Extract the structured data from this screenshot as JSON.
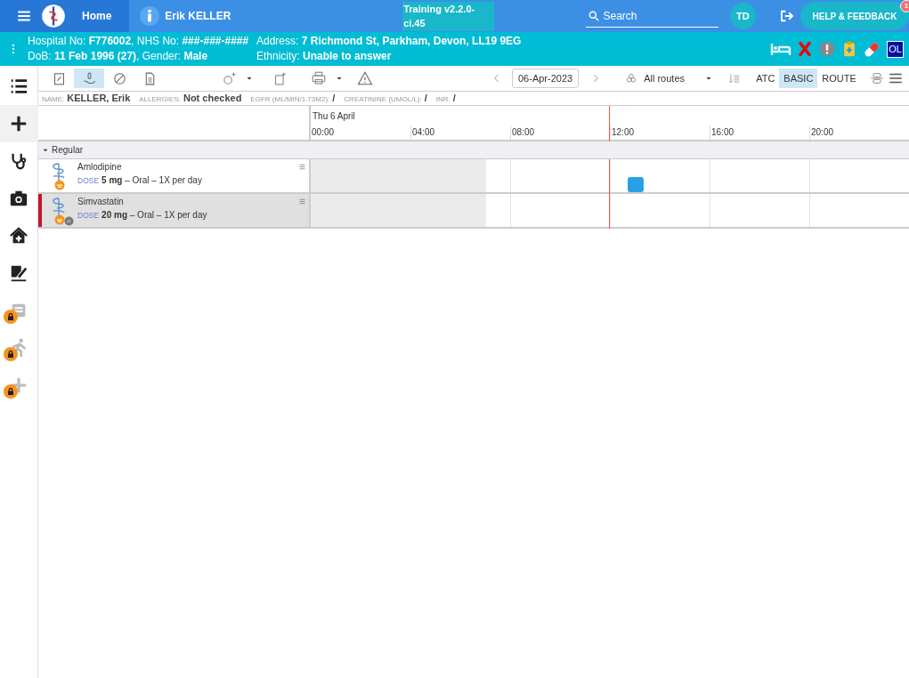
{
  "top_bar": {
    "home": "Home",
    "patient": "Erik KELLER",
    "environment": "Training v2.2.0-ci.45",
    "search_placeholder": "Search",
    "user_initials": "TD",
    "help": "HELP & FEEDBACK",
    "help_count": "1"
  },
  "banner": {
    "line1_left": "Hospital No: **F776002**, NHS No: **###-###-####**",
    "line2_left": "DoB: **11 Feb 1996 (27)**, Gender: **Male**",
    "line1_right": "Address: **7 Richmond St, Parkham, Devon, LL19 9EG**",
    "line2_right": "Ethnicity: **Unable to answer**",
    "badge": "OL"
  },
  "sidebar": {
    "items": [
      {
        "kind": "list",
        "locked": false,
        "selected": false
      },
      {
        "kind": "plus",
        "locked": false,
        "selected": true
      },
      {
        "kind": "stethoscope",
        "locked": false,
        "selected": false
      },
      {
        "kind": "camera",
        "locked": false,
        "selected": false
      },
      {
        "kind": "house",
        "locked": false,
        "selected": false
      },
      {
        "kind": "sign",
        "locked": false,
        "selected": false
      },
      {
        "kind": "clipboard",
        "locked": true,
        "selected": false
      },
      {
        "kind": "walk",
        "locked": true,
        "selected": false
      },
      {
        "kind": "plus",
        "locked": true,
        "selected": false
      }
    ]
  },
  "toolbar": {
    "tools": [
      {
        "kind": "chart",
        "selected": false
      },
      {
        "kind": "hand",
        "selected": true
      },
      {
        "kind": "pill",
        "selected": false
      },
      {
        "kind": "doc",
        "selected": false
      }
    ],
    "date": "06-Apr-2023",
    "routes": "All routes",
    "views": [
      {
        "label": "ATC",
        "selected": false
      },
      {
        "label": "BASIC",
        "selected": true
      },
      {
        "label": "ROUTE",
        "selected": false
      }
    ]
  },
  "info": [
    {
      "label": "NAME:",
      "value": "KELLER, Erik"
    },
    {
      "label": "ALLERGIES:",
      "value": "Not checked"
    },
    {
      "label": "EGFR (ML/MIN/1.73M2):",
      "value": "/"
    },
    {
      "label": "CREATININE (UMOL/L):",
      "value": "/"
    },
    {
      "label": "INR:",
      "value": "/"
    }
  ],
  "timeline": {
    "day": "Thu 6 April",
    "ticks": [
      "00:00",
      "04:00",
      "08:00",
      "12:00",
      "16:00",
      "20:00"
    ]
  },
  "group": {
    "label": "Regular",
    "expanded": true
  },
  "rows": [
    {
      "name": "Amlodipine",
      "dose_label": "DOSE",
      "dose": "**5 mg** – Oral – 1X per day",
      "selected": false,
      "extra_badge": false,
      "dose_due": true
    },
    {
      "name": "Simvastatin",
      "dose_label": "DOSE",
      "dose": "**20 mg** – Oral – 1X per day",
      "selected": true,
      "extra_badge": true,
      "dose_due": false
    }
  ]
}
